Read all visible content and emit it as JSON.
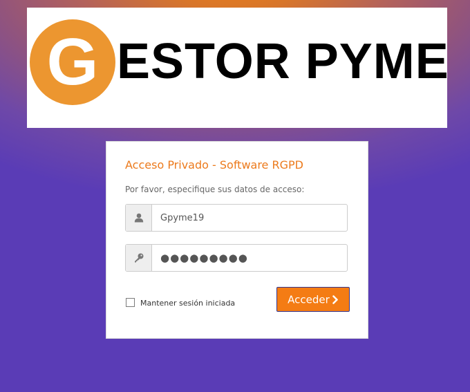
{
  "logo": {
    "letter": "G",
    "text": "ESTOR PYME"
  },
  "login": {
    "title": "Acceso Privado - Software RGPD",
    "subtitle": "Por favor, especifique sus datos de acceso:",
    "username_value": "Gpyme19",
    "password_value": "●●●●●●●●●",
    "remember_label": "Mantener sesión iniciada",
    "submit_label": "Acceder"
  },
  "icons": {
    "username": "user-icon",
    "password": "key-icon",
    "submit": "chevron-right-icon"
  },
  "colors": {
    "accent": "#f47c14",
    "title": "#ec7a1c",
    "logo_circle": "#ec9630"
  }
}
